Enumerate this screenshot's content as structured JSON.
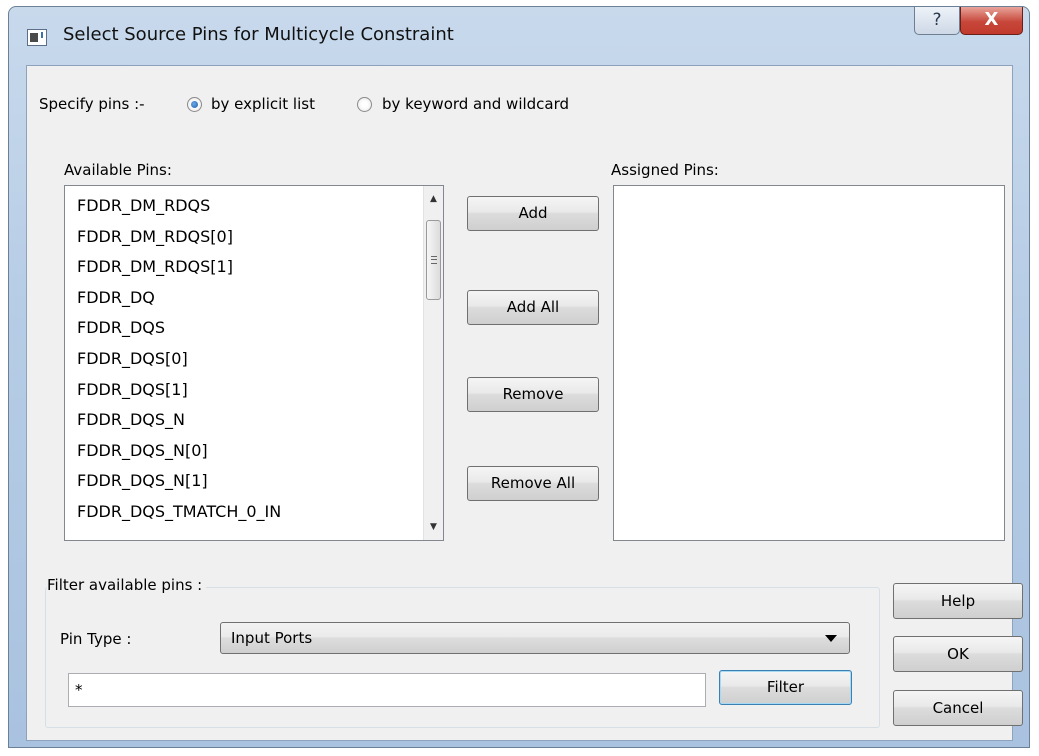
{
  "window": {
    "title": "Select Source Pins for Multicycle Constraint",
    "help_glyph": "?",
    "close_glyph": "X"
  },
  "specify": {
    "label": "Specify pins :-",
    "options": [
      {
        "label": "by explicit list",
        "selected": true
      },
      {
        "label": "by keyword and wildcard",
        "selected": false
      }
    ]
  },
  "available": {
    "label": "Available Pins:",
    "items": [
      "FDDR_DM_RDQS",
      "FDDR_DM_RDQS[0]",
      "FDDR_DM_RDQS[1]",
      "FDDR_DQ",
      "FDDR_DQS",
      "FDDR_DQS[0]",
      "FDDR_DQS[1]",
      "FDDR_DQS_N",
      "FDDR_DQS_N[0]",
      "FDDR_DQS_N[1]",
      "FDDR_DQS_TMATCH_0_IN"
    ]
  },
  "assigned": {
    "label": "Assigned Pins:",
    "items": []
  },
  "actions": {
    "add": "Add",
    "add_all": "Add All",
    "remove": "Remove",
    "remove_all": "Remove All"
  },
  "filter": {
    "group_label": "Filter available pins :",
    "pin_type_label": "Pin Type :",
    "pin_type_value": "Input Ports",
    "pattern_value": "*",
    "button": "Filter"
  },
  "dialog_buttons": {
    "help": "Help",
    "ok": "OK",
    "cancel": "Cancel"
  },
  "icons": {
    "window_icon": "dialog-window-icon",
    "scroll_up": "scroll-up-arrow-icon",
    "scroll_down": "scroll-down-arrow-icon",
    "combo": "chevron-down-icon"
  }
}
